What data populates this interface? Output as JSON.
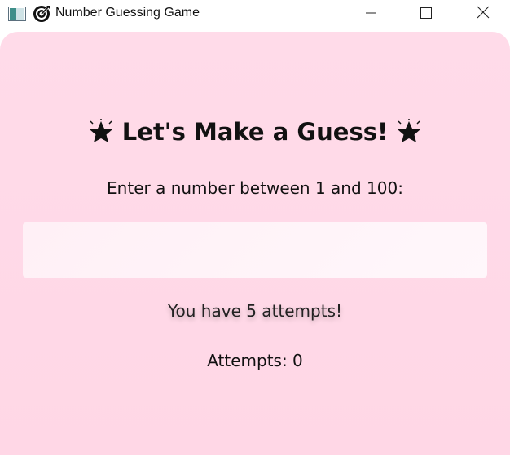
{
  "window": {
    "title": "Number Guessing Game",
    "app_icon": "window-app-icon",
    "title_icon": "target-icon",
    "controls": {
      "minimize_icon": "minimize-icon",
      "maximize_icon": "maximize-icon",
      "close_icon": "close-icon"
    }
  },
  "game": {
    "heading_text": "Let's Make a Guess!",
    "heading_icon": "star-icon",
    "prompt": "Enter a number between 1 and 100:",
    "guess_input": {
      "value": "",
      "placeholder": ""
    },
    "attempts_left": "You have 5 attempts!",
    "attempts_count": "Attempts: 0"
  },
  "colors": {
    "background": "#ffd9e8",
    "input_background": "#fff3f8",
    "text": "#111111"
  }
}
